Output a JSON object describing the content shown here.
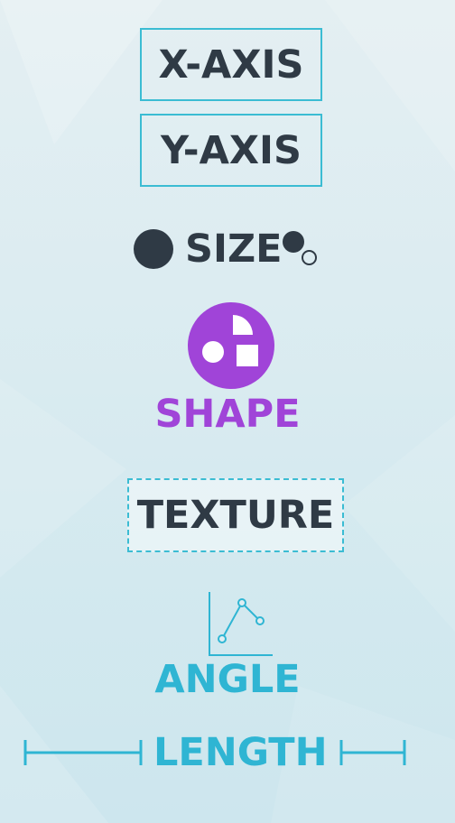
{
  "labels": {
    "x_axis": "X-AXIS",
    "y_axis": "Y-AXIS",
    "size": "SIZE",
    "shape": "SHAPE",
    "texture": "TEXTURE",
    "angle": "ANGLE",
    "length": "LENGTH"
  },
  "icons": {
    "size_large": "filled-circle-icon",
    "size_small": "small-circles-icon",
    "shape": "shapes-icon",
    "angle": "angle-line-chart-icon",
    "length_left": "length-bar-icon",
    "length_right": "length-bar-icon"
  },
  "colors": {
    "background": "#dcecf1",
    "dark_text": "#2f3a45",
    "accent_cyan": "#3bbcd3",
    "accent_blue_text": "#2fb5d3",
    "accent_purple": "#a044d8"
  }
}
